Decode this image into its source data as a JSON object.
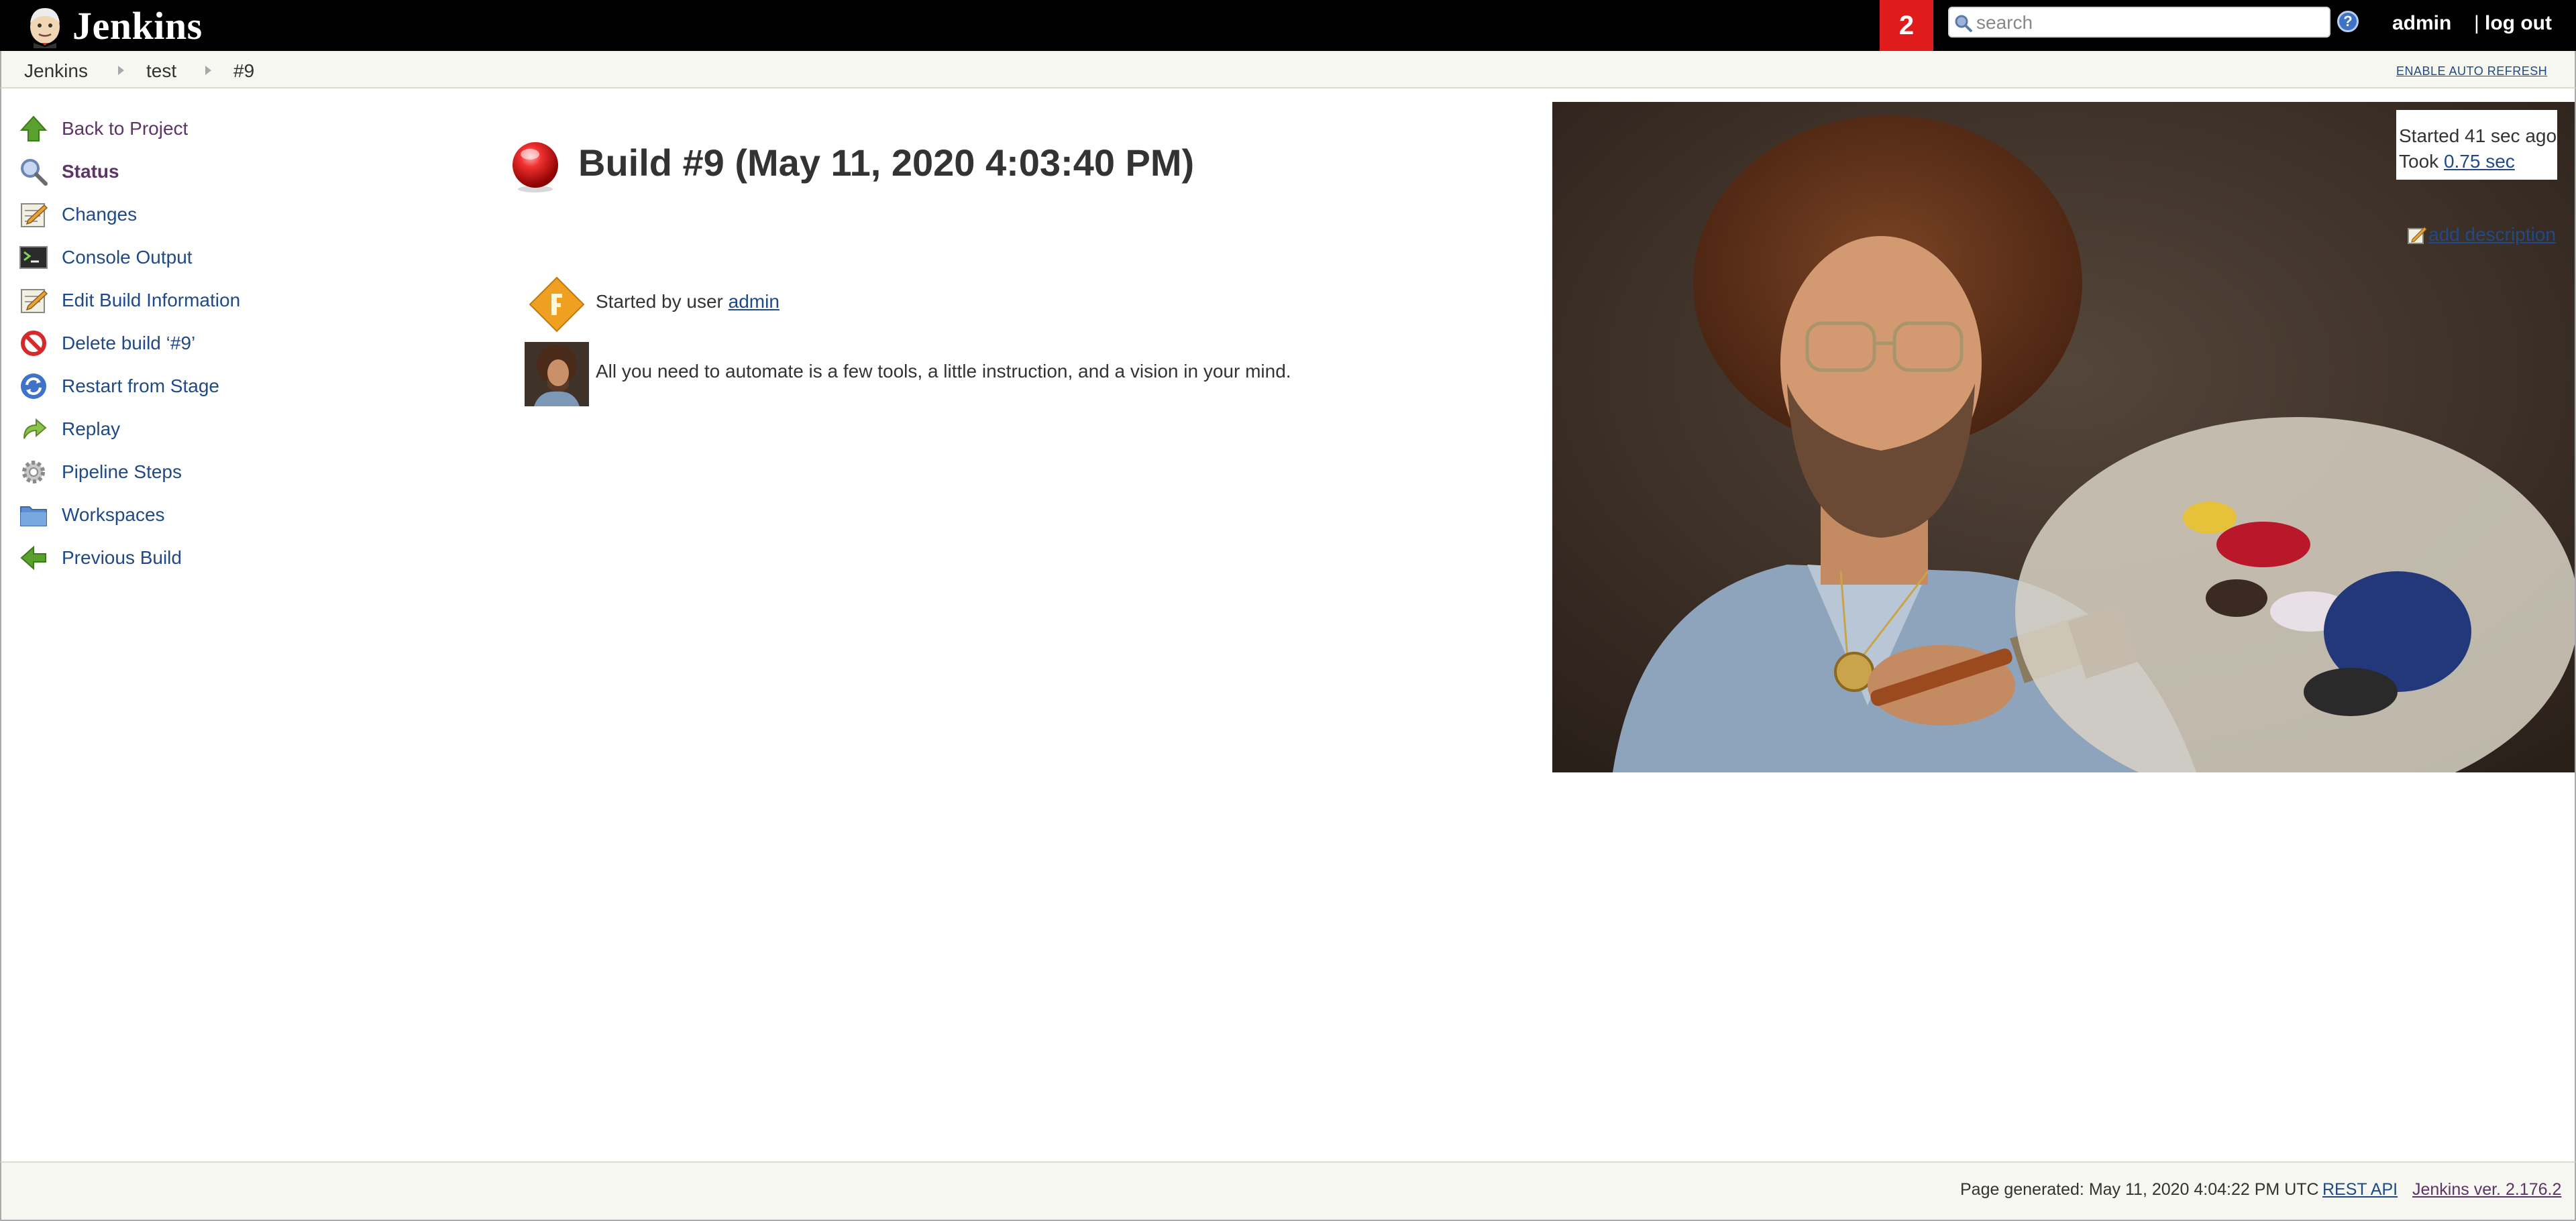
{
  "header": {
    "logo_text": "Jenkins",
    "notification_count": "2",
    "search_placeholder": "search",
    "user": "admin",
    "logout_separator": "|",
    "logout_label": "log out"
  },
  "breadcrumb": {
    "items": [
      "Jenkins",
      "test",
      "#9"
    ],
    "auto_refresh_label": "ENABLE AUTO REFRESH"
  },
  "sidebar": {
    "items": [
      {
        "label": "Back to Project",
        "icon": "up-arrow-icon"
      },
      {
        "label": "Status",
        "icon": "magnifier-icon"
      },
      {
        "label": "Changes",
        "icon": "notepad-icon"
      },
      {
        "label": "Console Output",
        "icon": "terminal-icon"
      },
      {
        "label": "Edit Build Information",
        "icon": "notepad-edit-icon"
      },
      {
        "label": "Delete build ‘#9’",
        "icon": "no-entry-icon"
      },
      {
        "label": "Restart from Stage",
        "icon": "refresh-icon"
      },
      {
        "label": "Replay",
        "icon": "replay-arrow-icon"
      },
      {
        "label": "Pipeline Steps",
        "icon": "gear-icon"
      },
      {
        "label": "Workspaces",
        "icon": "folder-icon"
      },
      {
        "label": "Previous Build",
        "icon": "left-arrow-icon"
      }
    ]
  },
  "main": {
    "build_title": "Build #9 (May 11, 2020 4:03:40 PM)",
    "cause_prefix": "Started by user ",
    "cause_user": "admin",
    "description": "All you need to automate is a few tools, a little instruction, and a vision in your mind."
  },
  "build_info": {
    "started": "Started 41 sec ago",
    "took_prefix": "Took ",
    "took_value": "0.75 sec",
    "add_description": "add description"
  },
  "footer": {
    "page_generated": "Page generated: May 11, 2020 4:04:22 PM UTC",
    "rest_api": "REST API",
    "jenkins_version": "Jenkins ver. 2.176.2"
  },
  "colors": {
    "header_bg": "#000000",
    "notification_bg": "#e01b1b",
    "link": "#204a87",
    "visited_link": "#5c3566",
    "build_failed": "#e02020"
  }
}
